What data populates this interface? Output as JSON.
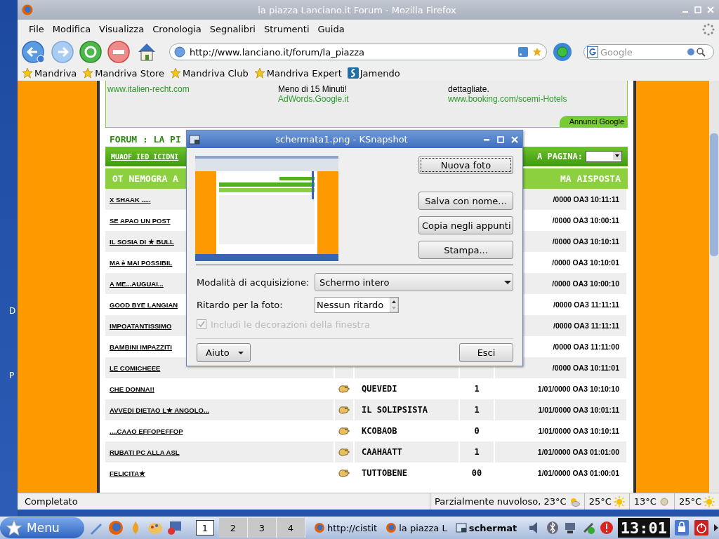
{
  "desktop": {
    "icon_labels": [
      "D",
      "P"
    ]
  },
  "browser": {
    "title": "la piazza Lanciano.it Forum - Mozilla Firefox",
    "menu": [
      "File",
      "Modifica",
      "Visualizza",
      "Cronologia",
      "Segnalibri",
      "Strumenti",
      "Guida"
    ],
    "url": "http://www.lanciano.it/forum/la_piazza",
    "search": {
      "placeholder": "Google"
    },
    "bookmarks": [
      "Mandriva",
      "Mandriva Store",
      "Mandriva Club",
      "Mandriva Expert",
      "Jamendo"
    ],
    "ads": [
      {
        "lines": [
          {
            "text": "www.italien-recht.com",
            "kind": "link"
          }
        ]
      },
      {
        "lines": [
          {
            "text": "Meno di 15 Minuti!",
            "kind": "text"
          },
          {
            "text": "AdWords.Google.it",
            "kind": "link"
          }
        ]
      },
      {
        "lines": [
          {
            "text": "dettagliate.",
            "kind": "text"
          },
          {
            "text": "www.booking.com/scemi-Hotels",
            "kind": "link"
          }
        ]
      }
    ],
    "ads_badge": "Annunci Google",
    "forum": {
      "title": "FORUM : LA PI",
      "nav_link": "MUAOF IED ICIDNI",
      "page_label": "A PAGINA:",
      "columns": [
        "OT NEMOGRA A",
        "MA AISPOSTA"
      ],
      "rows": [
        {
          "topic": "X SHAAK .....",
          "last_post": "/0000 OA3 10:11:11"
        },
        {
          "topic": "SE APAO UN POST",
          "last_post": "/0000 OA3 10:00:11"
        },
        {
          "topic": "IL SOSIA DI ★ BULL",
          "last_post": "/0000 OA3 10:10:11"
        },
        {
          "topic": "MA è MAI POSSIBIL",
          "last_post": "/0000 OA3 10:10:01"
        },
        {
          "topic": "A ME...AUGUAI...",
          "last_post": "/0000 OA3 10:00:10"
        },
        {
          "topic": "GOOD BYE LANGIAN",
          "last_post": "/0000 OA3 11:11:11"
        },
        {
          "topic": "IMPOATANTISSIMO",
          "last_post": "/0000 OA3 11:11:11"
        },
        {
          "topic": "BAMBINI IMPAZZITI",
          "last_post": "/0000 OA3 11:11:00"
        },
        {
          "topic": "LE COMICHEEE",
          "last_post": "/0000 OA3 10:11:01"
        },
        {
          "topic": "CHE DONNA!!",
          "author": "QUEVEDI",
          "replies": "1",
          "last_post": "1/01/0000 OA3 10:10:10"
        },
        {
          "topic": "AVVEDI DIETAO L★ ANGOLO...",
          "author": "IL SOLIPSISTA",
          "replies": "1",
          "last_post": "1/01/0000 OA3 10:01:11"
        },
        {
          "topic": "....CAAO EFFOPEFFOP",
          "author": "KCOBAOB",
          "replies": "0",
          "last_post": "1/01/0000 OA3 10:10:11"
        },
        {
          "topic": "RUBATI PC ALLA ASL",
          "author": "CAAHAATT",
          "replies": "1",
          "last_post": "1/01/0000 OA3 01:01:00"
        },
        {
          "topic": "FELICITA★",
          "author": "TUTTOBENE",
          "replies": "00",
          "last_post": "1/01/0000 OA3 01:00:01"
        }
      ]
    },
    "status_bar": {
      "text": "Completato",
      "weather": [
        {
          "text": "Parzialmente nuvoloso, 23°C",
          "kind": "cloud"
        },
        {
          "text": "25°C",
          "kind": "sun"
        },
        {
          "text": "13°C",
          "kind": "moon"
        },
        {
          "text": "25°C",
          "kind": "sun"
        }
      ]
    }
  },
  "dialog": {
    "title": "schermata1.png - KSnapshot",
    "buttons": [
      "Nuova foto",
      "Salva con nome...",
      "Copia negli appunti",
      "Stampa..."
    ],
    "mode_label": "Modalità di acquisizione:",
    "mode_value": "Schermo intero",
    "delay_label": "Ritardo per la foto:",
    "delay_value": "Nessun ritardo",
    "checkbox": {
      "label": "Includi le decorazioni della finestra",
      "checked": true,
      "disabled": true
    },
    "help_button": "Aiuto",
    "close_button": "Esci"
  },
  "taskbar": {
    "menu": "Menu",
    "desktops": [
      {
        "label": "1",
        "selected": true
      },
      {
        "label": "2",
        "selected": false
      },
      {
        "label": "3",
        "selected": false
      },
      {
        "label": "4",
        "selected": false
      }
    ],
    "tasks": [
      {
        "label": "http://cistit",
        "selected": false
      },
      {
        "label": "la piazza L",
        "selected": false
      },
      {
        "label": "schermat",
        "selected": true
      }
    ],
    "clock": "13:01"
  }
}
